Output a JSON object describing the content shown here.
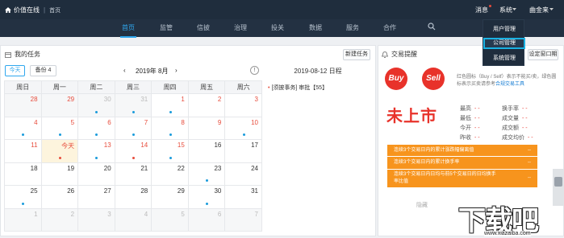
{
  "app": {
    "title": "价值在线",
    "crumb": "首页"
  },
  "topbar": {
    "messages": "消息",
    "system_menu": "系统",
    "user": "曲金来"
  },
  "nav": [
    "首页",
    "监管",
    "信披",
    "治理",
    "投关",
    "数据",
    "服务",
    "合作"
  ],
  "dropdown": {
    "items": [
      "用户管理",
      "公司管理",
      "系统管理"
    ],
    "selected": "公司管理"
  },
  "tasks": {
    "title": "我的任务",
    "new_task": "新建任务",
    "today": "今天",
    "backlog": "备份 4",
    "month_label": "2019年 8月",
    "info": "!",
    "weekdays": [
      "周日",
      "周一",
      "周二",
      "周三",
      "周四",
      "周五",
      "周六"
    ],
    "weeks": [
      [
        "28",
        "29",
        "30",
        "31",
        "1",
        "2",
        "3"
      ],
      [
        "4",
        "5",
        "6",
        "7",
        "8",
        "9",
        "10"
      ],
      [
        "11",
        "今天",
        "13",
        "14",
        "15",
        "16",
        "17"
      ],
      [
        "18",
        "19",
        "20",
        "21",
        "22",
        "23",
        "24"
      ],
      [
        "25",
        "26",
        "27",
        "28",
        "29",
        "30",
        "31"
      ],
      [
        "1",
        "2",
        "3",
        "4",
        "5",
        "6",
        "7"
      ]
    ],
    "schedule_header": "2019-08-12 日程",
    "schedule_item": "[须披事务] 审批【55】"
  },
  "stock": {
    "title": "交易提醒",
    "set_window": "设定窗口期",
    "logo_buy": "Buy",
    "logo_sell": "Sell",
    "note_text": "红色圆标（Buy / Self）表示不能买/卖，绿色圆标表示买卖请参考",
    "note_link": "合规交易工具",
    "name": "未上市",
    "fields": [
      {
        "label": "最高",
        "value": "- -"
      },
      {
        "label": "换手率",
        "value": "- -"
      },
      {
        "label": "最低",
        "value": "- -"
      },
      {
        "label": "成交量",
        "value": "- -"
      },
      {
        "label": "今开",
        "value": "- -"
      },
      {
        "label": "成交额",
        "value": "- -"
      },
      {
        "label": "昨收",
        "value": "- -"
      },
      {
        "label": "成交均价",
        "value": "- -"
      }
    ],
    "rows": [
      {
        "label": "连续3个交易日内的累计涨跌幅偏离值",
        "value": "--"
      },
      {
        "label": "连续3个交易日内的累计换手率",
        "value": "--"
      },
      {
        "label": "连续3个交易日内日均与前5个交易日的日均换手率比值",
        "value": "--"
      }
    ],
    "hide": "隐藏"
  },
  "watermark": {
    "text": "下载吧",
    "url": "www.xiazaiba.com"
  }
}
